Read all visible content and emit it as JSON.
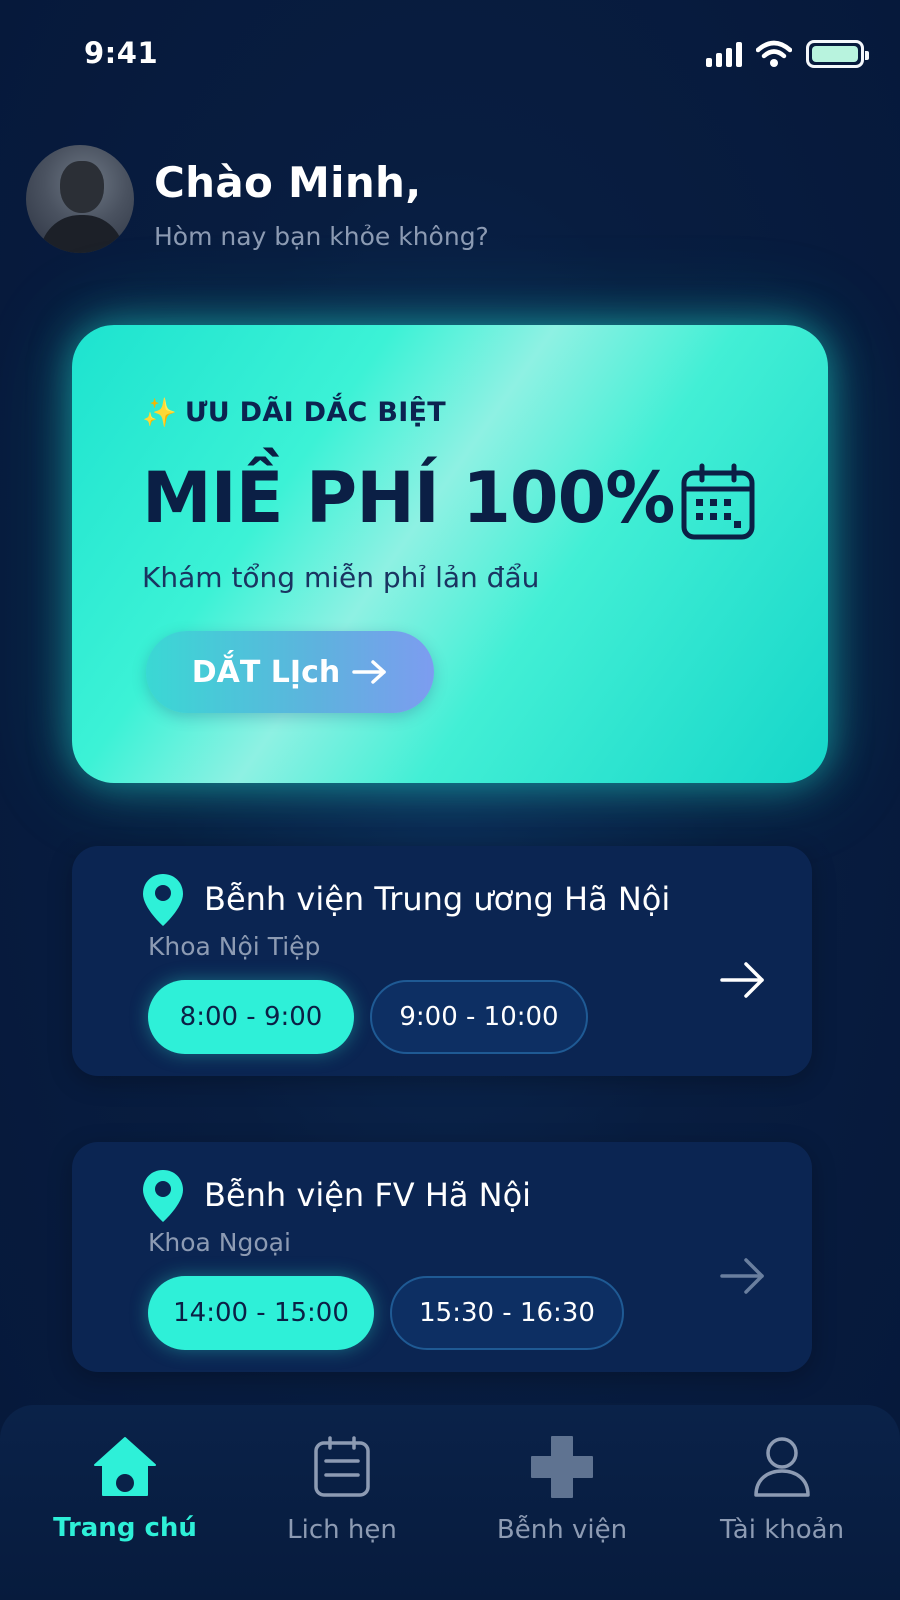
{
  "status_bar": {
    "time": "9:41"
  },
  "header": {
    "greeting": "Chào Minh,",
    "subtitle": "Hòm nay bạn khỏe không?"
  },
  "promo": {
    "eyebrow": "ƯU DÃI DẮC BIỆT",
    "title": "MIỀ PHÍ 100%",
    "subtitle": "Khám tổng miễn phỉ lản đẩu",
    "button_label": "DẮT LỊch",
    "accent_color": "#2ef0d8"
  },
  "appointments": [
    {
      "hospital": "Bễnh viện Trung ương Hã Nội",
      "department": "Khoa Nội Tiệp",
      "slots": [
        "8:00 - 9:00",
        "9:00 - 10:00"
      ],
      "selected_slot": "8:00 - 9:00"
    },
    {
      "hospital": "Bễnh viện FV Hã Nội",
      "department": "Khoa Ngoại",
      "slots": [
        "14:00 - 15:00",
        "15:30 - 16:30"
      ],
      "selected_slot": "14:00 - 15:00"
    }
  ],
  "bottom_nav": {
    "items": [
      {
        "label": "Trang chú",
        "icon": "home-icon",
        "active": true
      },
      {
        "label": "Lich hẹn",
        "icon": "schedule-icon",
        "active": false
      },
      {
        "label": "Bễnh viện",
        "icon": "hospital-cross-icon",
        "active": false
      },
      {
        "label": "Tài khoản",
        "icon": "account-icon",
        "active": false
      }
    ]
  }
}
